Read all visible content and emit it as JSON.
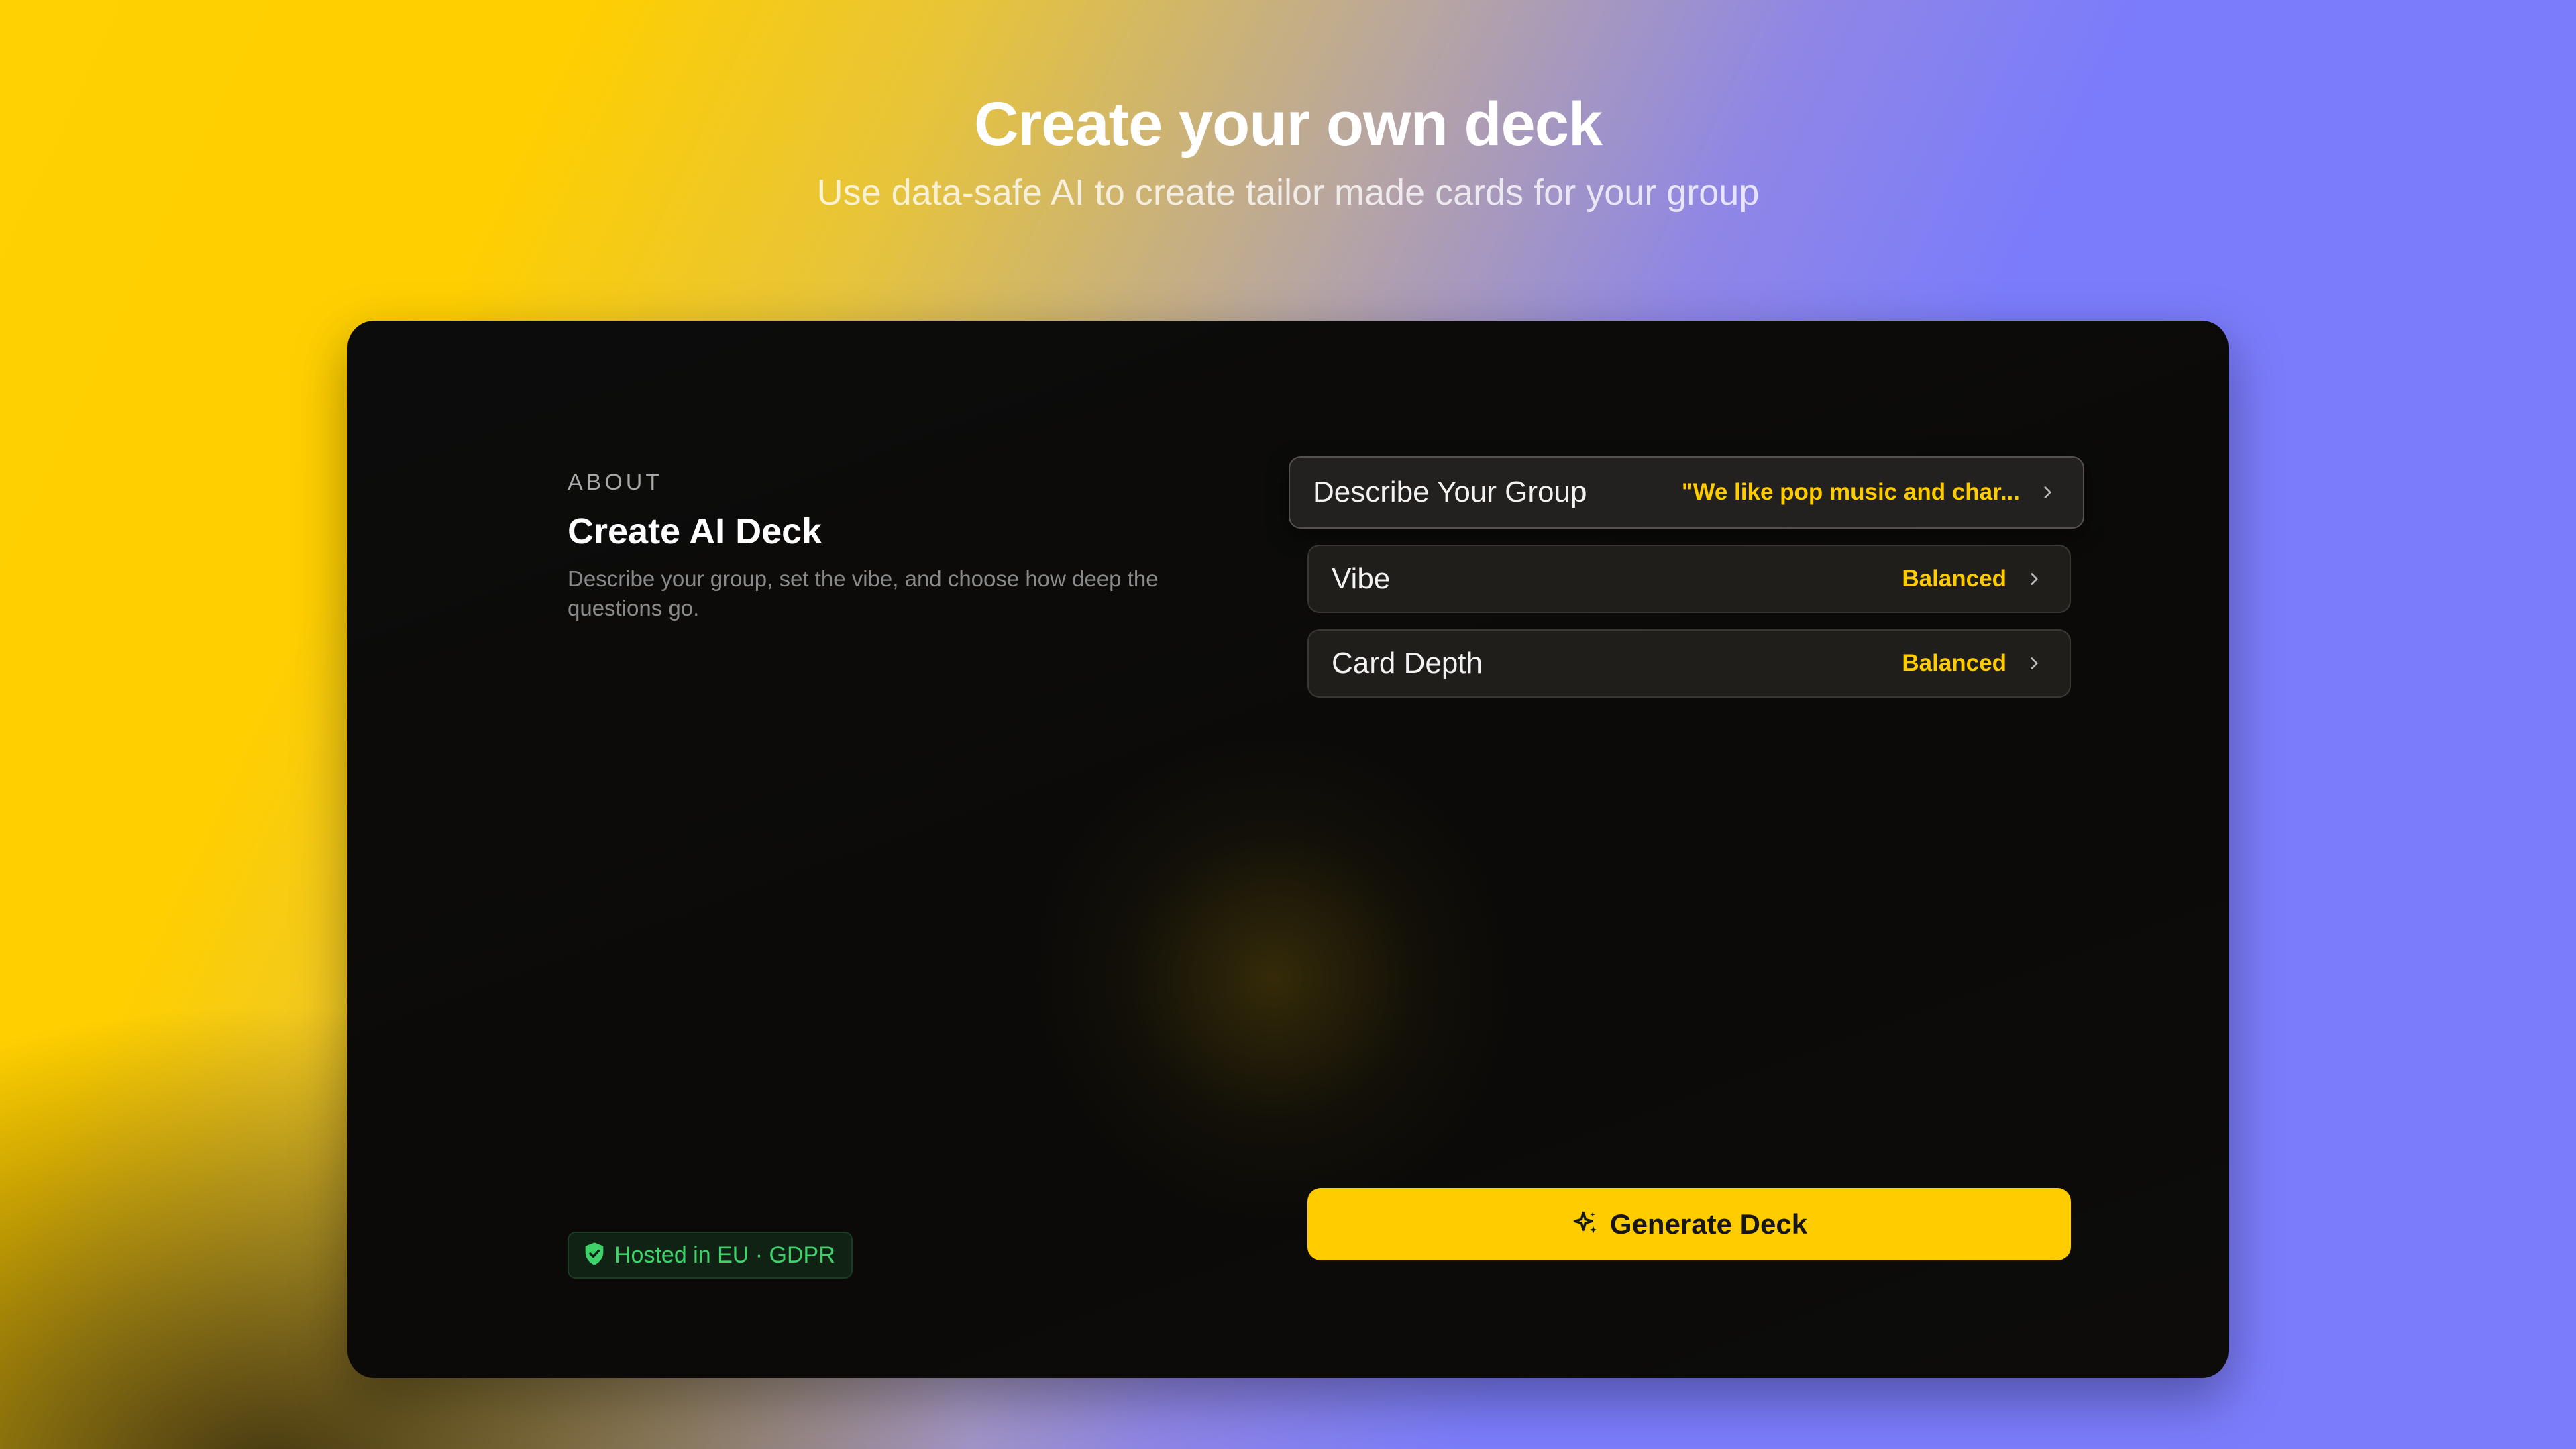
{
  "header": {
    "title": "Create your own deck",
    "subtitle": "Use data-safe AI to create tailor made cards for your group"
  },
  "about": {
    "eyebrow": "ABOUT",
    "title": "Create AI Deck",
    "description": "Describe your group, set the vibe, and choose how deep the questions go."
  },
  "settings": [
    {
      "label": "Describe Your Group",
      "value": "\"We like pop music and char...",
      "icon": "chevron-right-icon"
    },
    {
      "label": "Vibe",
      "value": "Balanced",
      "icon": "chevron-right-icon"
    },
    {
      "label": "Card Depth",
      "value": "Balanced",
      "icon": "chevron-right-icon"
    }
  ],
  "badge": {
    "text": "Hosted in EU · GDPR",
    "icon": "shield-check-icon",
    "color": "#3fd16a"
  },
  "generate": {
    "label": "Generate Deck",
    "icon": "sparkles-icon",
    "color": "#ffcc00"
  },
  "colors": {
    "accent": "#ffcc00",
    "panel": "#0c0c0c",
    "background_left": "#ffd200",
    "background_right": "#7b7cfb"
  }
}
